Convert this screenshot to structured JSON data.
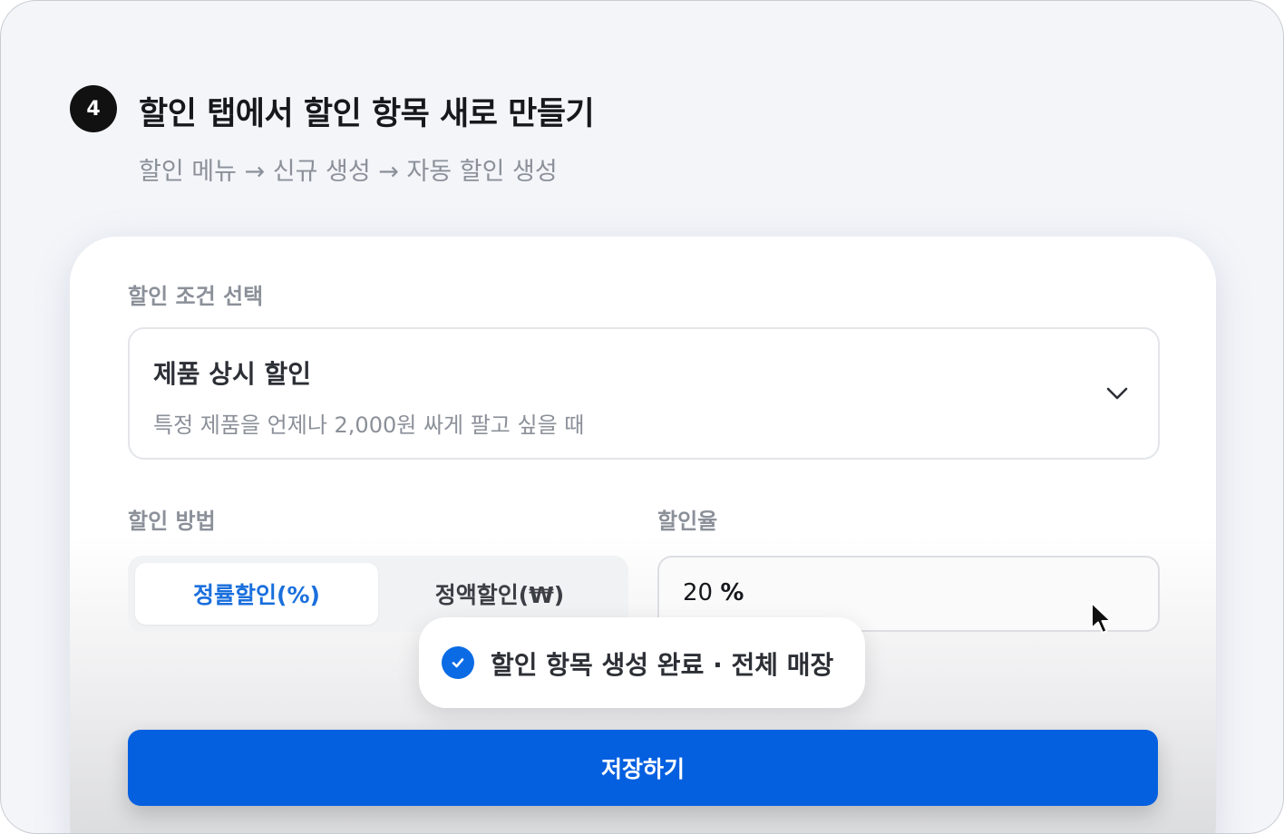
{
  "step": {
    "number": "4",
    "title": "할인 탭에서 할인 항목 새로 만들기",
    "breadcrumb": "할인 메뉴 → 신규 생성 → 자동 할인 생성"
  },
  "condition": {
    "label": "할인 조건 선택",
    "selected_title": "제품 상시 할인",
    "selected_description": "특정 제품을 언제나 2,000원 싸게 팔고 싶을 때",
    "icon": "chevron-down-icon"
  },
  "method": {
    "label": "할인 방법",
    "options": [
      "정률할인(%)",
      "정액할인(₩)"
    ],
    "selected": "정률할인(%)"
  },
  "rate": {
    "label": "할인율",
    "value": "20",
    "unit": "%"
  },
  "toast": {
    "icon": "check-circle-icon",
    "message": "할인 항목 생성 완료 · 전체 매장"
  },
  "actions": {
    "save_label": "저장하기"
  },
  "colors": {
    "primary": "#0560e0",
    "active_text": "#1a6fdc",
    "badge": "#111111"
  }
}
